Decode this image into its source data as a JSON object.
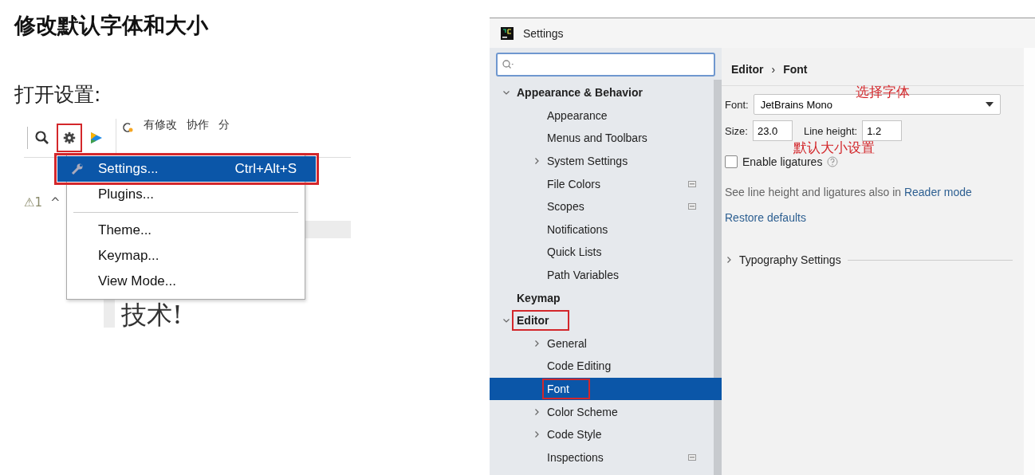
{
  "heading": "修改默认字体和大小",
  "step": "打开设置:",
  "ide_snippet": {
    "toolbar_texts": [
      "有修改",
      "协作",
      "分"
    ],
    "gear_annotated": true,
    "warning_icon": "⚠",
    "warning_count": "1",
    "warning_caret": "^",
    "document_text": "技术!",
    "menu": [
      {
        "label": "Settings...",
        "shortcut": "Ctrl+Alt+S",
        "selected": true,
        "annotated": true,
        "separator_after": false
      },
      {
        "label": "Plugins...",
        "selected": false,
        "annotated": false,
        "separator_after": true
      },
      {
        "label": "Theme...",
        "selected": false,
        "annotated": false,
        "separator_after": false
      },
      {
        "label": "Keymap...",
        "selected": false,
        "annotated": false,
        "separator_after": false
      },
      {
        "label": "View Mode...",
        "selected": false,
        "annotated": false,
        "separator_after": false
      }
    ]
  },
  "settings": {
    "window": {
      "title": "Settings"
    },
    "tree": [
      {
        "label": "Appearance & Behavior",
        "bold": true,
        "expanded": true,
        "selected": false,
        "annotated": false,
        "children": [
          {
            "label": "Appearance",
            "selected": false,
            "annotated": false
          },
          {
            "label": "Menus and Toolbars",
            "selected": false,
            "annotated": false
          },
          {
            "label": "System Settings",
            "expanded": false,
            "selected": false,
            "annotated": false
          },
          {
            "label": "File Colors",
            "project_badge": true,
            "selected": false,
            "annotated": false
          },
          {
            "label": "Scopes",
            "project_badge": true,
            "selected": false,
            "annotated": false
          },
          {
            "label": "Notifications",
            "selected": false,
            "annotated": false
          },
          {
            "label": "Quick Lists",
            "selected": false,
            "annotated": false
          },
          {
            "label": "Path Variables",
            "selected": false,
            "annotated": false
          }
        ]
      },
      {
        "label": "Keymap",
        "bold": true,
        "selected": false,
        "annotated": false
      },
      {
        "label": "Editor",
        "bold": true,
        "expanded": true,
        "selected": false,
        "annotated": true,
        "children": [
          {
            "label": "General",
            "expanded": false,
            "selected": false,
            "annotated": false
          },
          {
            "label": "Code Editing",
            "selected": false,
            "annotated": false
          },
          {
            "label": "Font",
            "selected": true,
            "annotated": true
          },
          {
            "label": "Color Scheme",
            "expanded": false,
            "selected": false,
            "annotated": false
          },
          {
            "label": "Code Style",
            "expanded": false,
            "selected": false,
            "annotated": false
          },
          {
            "label": "Inspections",
            "project_badge": true,
            "selected": false,
            "annotated": false
          }
        ]
      }
    ],
    "breadcrumb": [
      "Editor",
      "Font"
    ],
    "breadcrumb_separator": "›",
    "font_label": "Font:",
    "font_value": "JetBrains Mono",
    "font_note": "选择字体",
    "size_label": "Size:",
    "size_value": "23.0",
    "line_height_label": "Line height:",
    "line_height_value": "1.2",
    "size_note": "默认大小设置",
    "ligatures": {
      "label": "Enable ligatures",
      "checked": false
    },
    "hint_text": "See line height and ligatures also in",
    "hint_link": "Reader mode",
    "restore_link": "Restore defaults",
    "typography": {
      "label": "Typography Settings",
      "expanded": false
    }
  }
}
